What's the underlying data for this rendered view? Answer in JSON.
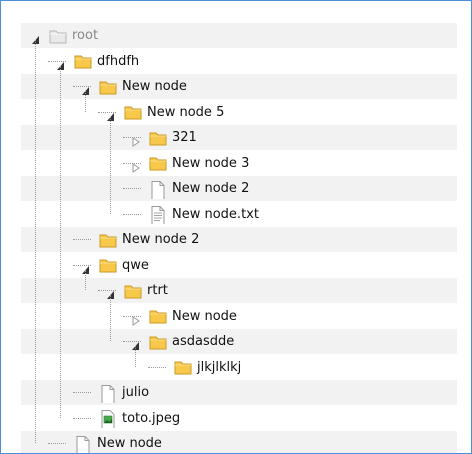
{
  "tree": {
    "nodes": [
      {
        "label": "root",
        "type": "folder-empty",
        "toggle": "expanded"
      },
      {
        "label": "dfhdfh",
        "type": "folder",
        "toggle": "expanded"
      },
      {
        "label": "New node",
        "type": "folder",
        "toggle": "expanded"
      },
      {
        "label": "New node 5",
        "type": "folder",
        "toggle": "expanded"
      },
      {
        "label": "321",
        "type": "folder",
        "toggle": "collapsed"
      },
      {
        "label": "New node 3",
        "type": "folder",
        "toggle": "collapsed"
      },
      {
        "label": "New node 2",
        "type": "file",
        "toggle": "none"
      },
      {
        "label": "New node.txt",
        "type": "text-file",
        "toggle": "none"
      },
      {
        "label": "New node 2",
        "type": "folder",
        "toggle": "none"
      },
      {
        "label": "qwe",
        "type": "folder",
        "toggle": "expanded"
      },
      {
        "label": "rtrt",
        "type": "folder",
        "toggle": "expanded"
      },
      {
        "label": "New node",
        "type": "folder",
        "toggle": "collapsed"
      },
      {
        "label": "asdasdde",
        "type": "folder",
        "toggle": "expanded"
      },
      {
        "label": "jlkjlklkj",
        "type": "folder",
        "toggle": "none"
      },
      {
        "label": "julio",
        "type": "file",
        "toggle": "none"
      },
      {
        "label": "toto.jpeg",
        "type": "image-file",
        "toggle": "none"
      },
      {
        "label": "New node",
        "type": "file",
        "toggle": "none"
      }
    ]
  },
  "colors": {
    "frame_border": "#4a8fd8",
    "row_stripe": "#f2f2f2",
    "folder_fill": "#f7c84a",
    "connector": "#999999"
  }
}
